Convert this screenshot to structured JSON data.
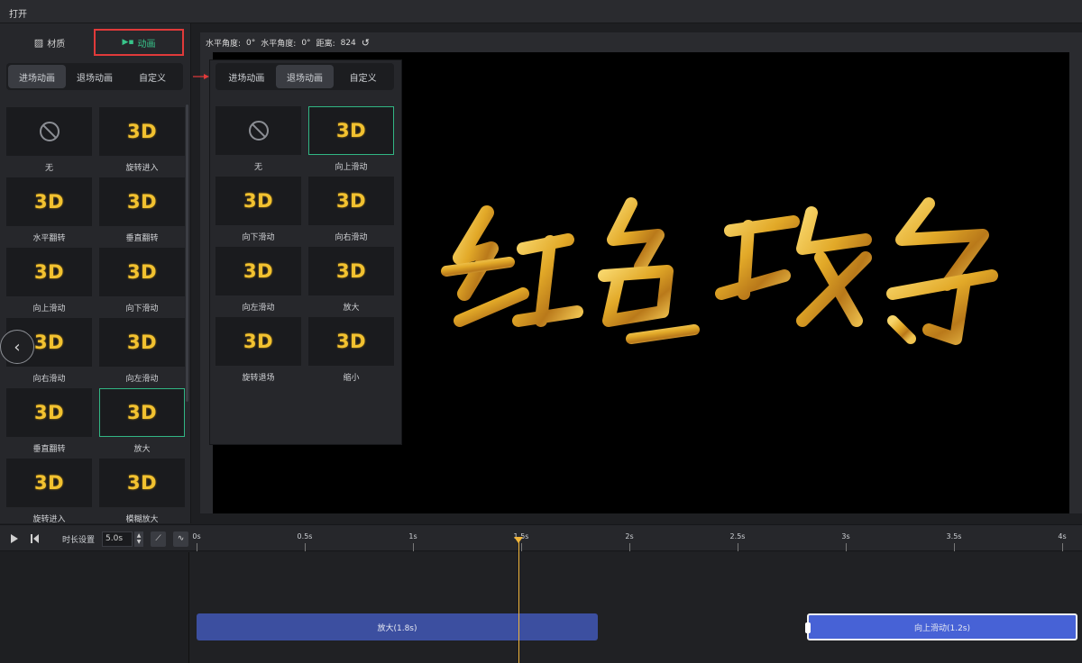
{
  "menu": {
    "open_label": "打开"
  },
  "left_tabs": {
    "material": "材质",
    "animation": "动画"
  },
  "anim_subtabs": [
    "进场动画",
    "退场动画",
    "自定义"
  ],
  "left_grid": [
    {
      "label": "无",
      "type": "none"
    },
    {
      "label": "旋转进入",
      "type": "3d"
    },
    {
      "label": "水平翻转",
      "type": "3d"
    },
    {
      "label": "垂直翻转",
      "type": "3d"
    },
    {
      "label": "向上滑动",
      "type": "3d"
    },
    {
      "label": "向下滑动",
      "type": "3d"
    },
    {
      "label": "向右滑动",
      "type": "3d"
    },
    {
      "label": "向左滑动",
      "type": "3d"
    },
    {
      "label": "垂直翻转",
      "type": "3d"
    },
    {
      "label": "放大",
      "type": "3d",
      "selected": true
    },
    {
      "label": "旋转进入",
      "type": "3d"
    },
    {
      "label": "模糊放大",
      "type": "3d"
    }
  ],
  "popup_subtabs": [
    "进场动画",
    "退场动画",
    "自定义"
  ],
  "popup_grid": [
    {
      "label": "无",
      "type": "none"
    },
    {
      "label": "向上滑动",
      "type": "3d",
      "selected": true
    },
    {
      "label": "向下滑动",
      "type": "3d"
    },
    {
      "label": "向右滑动",
      "type": "3d"
    },
    {
      "label": "向左滑动",
      "type": "3d"
    },
    {
      "label": "放大",
      "type": "3d"
    },
    {
      "label": "旋转退场",
      "type": "3d"
    },
    {
      "label": "缩小",
      "type": "3d"
    }
  ],
  "thumb_text": "3D",
  "readout": {
    "h_angle_label": "水平角度:",
    "h_angle_value": "0°",
    "h_angle2_label": "水平角度:",
    "h_angle2_value": "0°",
    "distance_label": "距离:",
    "distance_value": "824",
    "reset_icon": "↺"
  },
  "preview_art_text": "红色政务",
  "timeline": {
    "duration_label": "时长设置",
    "duration_value": "5.0s",
    "ticks": [
      "0s",
      "0.5s",
      "1s",
      "1.5s",
      "2s",
      "2.5s",
      "3s",
      "3.5s",
      "4s"
    ],
    "playhead_time": 1.5,
    "clips": [
      {
        "label": "放大(1.8s)"
      },
      {
        "label": "向上滑动(1.2s)"
      }
    ]
  },
  "colors": {
    "accent_green": "#38c58b",
    "highlight_red": "#e03a3a",
    "gold": "#f2c230",
    "playhead": "#f0b53a",
    "clip_in": "#3c4fa0",
    "clip_out": "#4762d6"
  }
}
